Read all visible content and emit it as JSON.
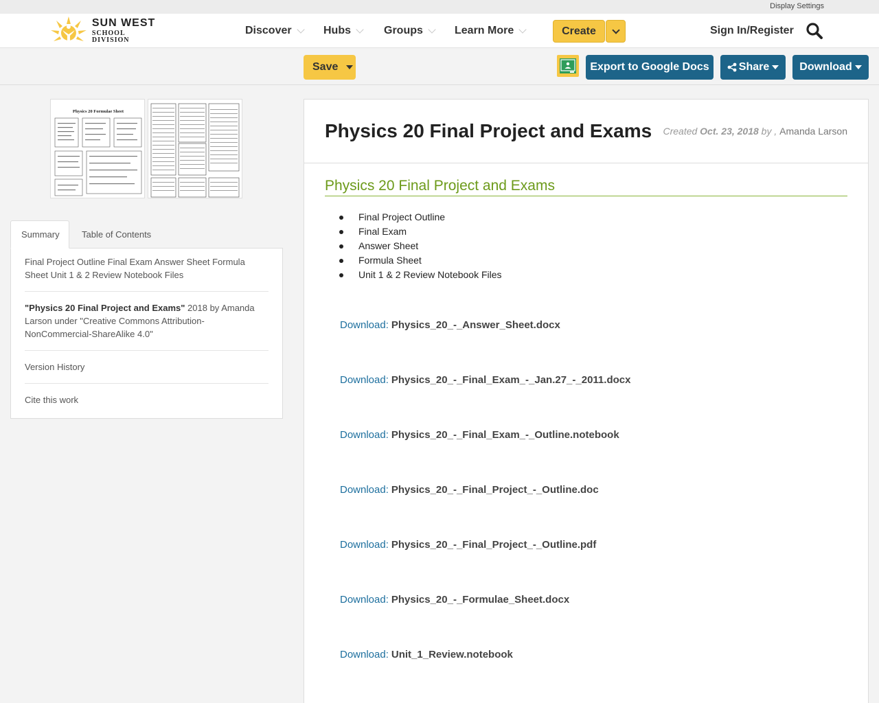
{
  "util_bar": {
    "display_settings": "Display Settings"
  },
  "brand": {
    "line1": "SUN WEST",
    "line2": "SCHOOL DIVISION"
  },
  "nav": {
    "items": [
      "Discover",
      "Hubs",
      "Groups",
      "Learn More"
    ],
    "create": "Create",
    "signin": "Sign In/Register"
  },
  "toolbar": {
    "save": "Save",
    "export": "Export to Google Docs",
    "share": "Share",
    "download": "Download"
  },
  "tabs": {
    "summary": "Summary",
    "toc": "Table of Contents"
  },
  "summary": {
    "description": "Final Project Outline Final Exam Answer Sheet Formula Sheet Unit 1 & 2 Review Notebook Files",
    "cite_title": "\"Physics 20 Final Project and Exams\"",
    "cite_rest": " 2018 by Amanda Larson under \"Creative Commons Attribution-NonCommercial-ShareAlike 4.0\"",
    "version_history": "Version History",
    "cite_work": "Cite this work"
  },
  "content": {
    "title": "Physics 20 Final Project and Exams",
    "created_label": "Created ",
    "created_date": "Oct. 23, 2018",
    "by_label": " by , ",
    "author": "Amanda Larson",
    "section_title": "Physics 20 Final Project and Exams",
    "bullets": [
      "Final Project Outline",
      "Final Exam",
      "Answer Sheet",
      "Formula Sheet",
      "Unit 1 & 2 Review Notebook Files"
    ],
    "download_label": "Download:",
    "files": [
      "Physics_20_-_Answer_Sheet.docx",
      "Physics_20_-_Final_Exam_-_Jan.27_-_2011.docx",
      "Physics_20_-_Final_Exam_-_Outline.notebook",
      "Physics_20_-_Final_Project_-_Outline.doc",
      "Physics_20_-_Final_Project_-_Outline.pdf",
      "Physics_20_-_Formulae_Sheet.docx",
      "Unit_1_Review.notebook"
    ]
  },
  "thumbnail": {
    "title": "Physics 20 Formulae Sheet"
  },
  "colors": {
    "yellow": "#f6c744",
    "blue": "#1d6489",
    "green": "#6c9a1a",
    "link": "#1d6f9e"
  }
}
